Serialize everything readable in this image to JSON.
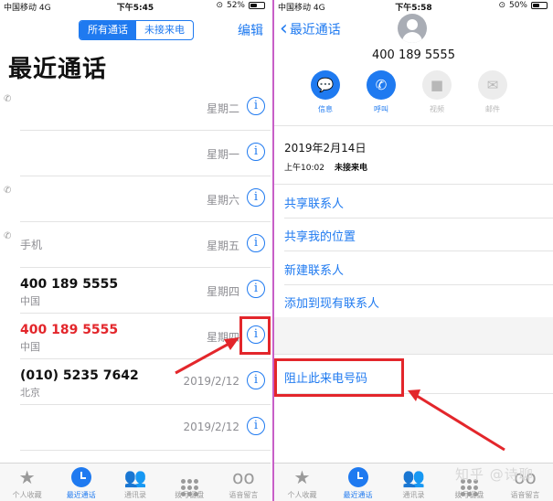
{
  "left": {
    "status": {
      "carrier": "中国移动 4G",
      "time": "下午5:45",
      "battery": "52%",
      "battery_level": 0.52
    },
    "segments": [
      "所有通话",
      "未接来电"
    ],
    "edit_label": "编辑",
    "title": "最近通话",
    "calls": [
      {
        "name": "",
        "sub": "",
        "date": "星期二",
        "handset": true,
        "missed": false
      },
      {
        "name": "",
        "sub": "",
        "date": "星期一",
        "handset": false,
        "missed": false
      },
      {
        "name": "",
        "sub": "",
        "date": "星期六",
        "handset": true,
        "missed": false
      },
      {
        "name": "",
        "sub": "手机",
        "date": "星期五",
        "handset": true,
        "missed": false
      },
      {
        "name": "400 189 5555",
        "sub": "中国",
        "date": "星期四",
        "handset": false,
        "missed": false
      },
      {
        "name": "400 189 5555",
        "sub": "中国",
        "date": "星期四",
        "handset": false,
        "missed": true
      },
      {
        "name": "(010) 5235 7642",
        "sub": "北京",
        "date": "2019/2/12",
        "handset": false,
        "missed": false
      },
      {
        "name": "",
        "sub": "",
        "date": "2019/2/12",
        "handset": false,
        "missed": false
      }
    ],
    "tabs": [
      {
        "label": "个人收藏",
        "icon": "star-icon"
      },
      {
        "label": "最近通话",
        "icon": "clock-icon"
      },
      {
        "label": "通讯录",
        "icon": "contacts-icon"
      },
      {
        "label": "拨号键盘",
        "icon": "keypad-icon"
      },
      {
        "label": "语音留言",
        "icon": "voicemail-icon"
      }
    ]
  },
  "right": {
    "status": {
      "carrier": "中国移动 4G",
      "time": "下午5:58",
      "battery": "50%",
      "battery_level": 0.5
    },
    "back_label": "最近通话",
    "number": "400 189 5555",
    "actions": [
      {
        "label": "信息",
        "icon": "message-icon",
        "enabled": true
      },
      {
        "label": "呼叫",
        "icon": "phone-icon",
        "enabled": true
      },
      {
        "label": "视频",
        "icon": "video-icon",
        "enabled": false
      },
      {
        "label": "邮件",
        "icon": "mail-icon",
        "enabled": false
      }
    ],
    "call_date": "2019年2月14日",
    "call_time": "上午10:02",
    "call_type": "未接来电",
    "options": [
      "共享联系人",
      "共享我的位置",
      "新建联系人",
      "添加到现有联系人"
    ],
    "block": "阻止此来电号码",
    "tabs": [
      {
        "label": "个人收藏",
        "icon": "star-icon"
      },
      {
        "label": "最近通话",
        "icon": "clock-icon"
      },
      {
        "label": "通讯录",
        "icon": "contacts-icon"
      },
      {
        "label": "拨号键盘",
        "icon": "keypad-icon"
      },
      {
        "label": "语音留言",
        "icon": "voicemail-icon"
      }
    ]
  },
  "watermark": "知乎 @诗聊",
  "colors": {
    "accent": "#1f7af0",
    "missed": "#e3262b",
    "annotation": "#e3262b",
    "gray_text": "#8e8e93"
  }
}
